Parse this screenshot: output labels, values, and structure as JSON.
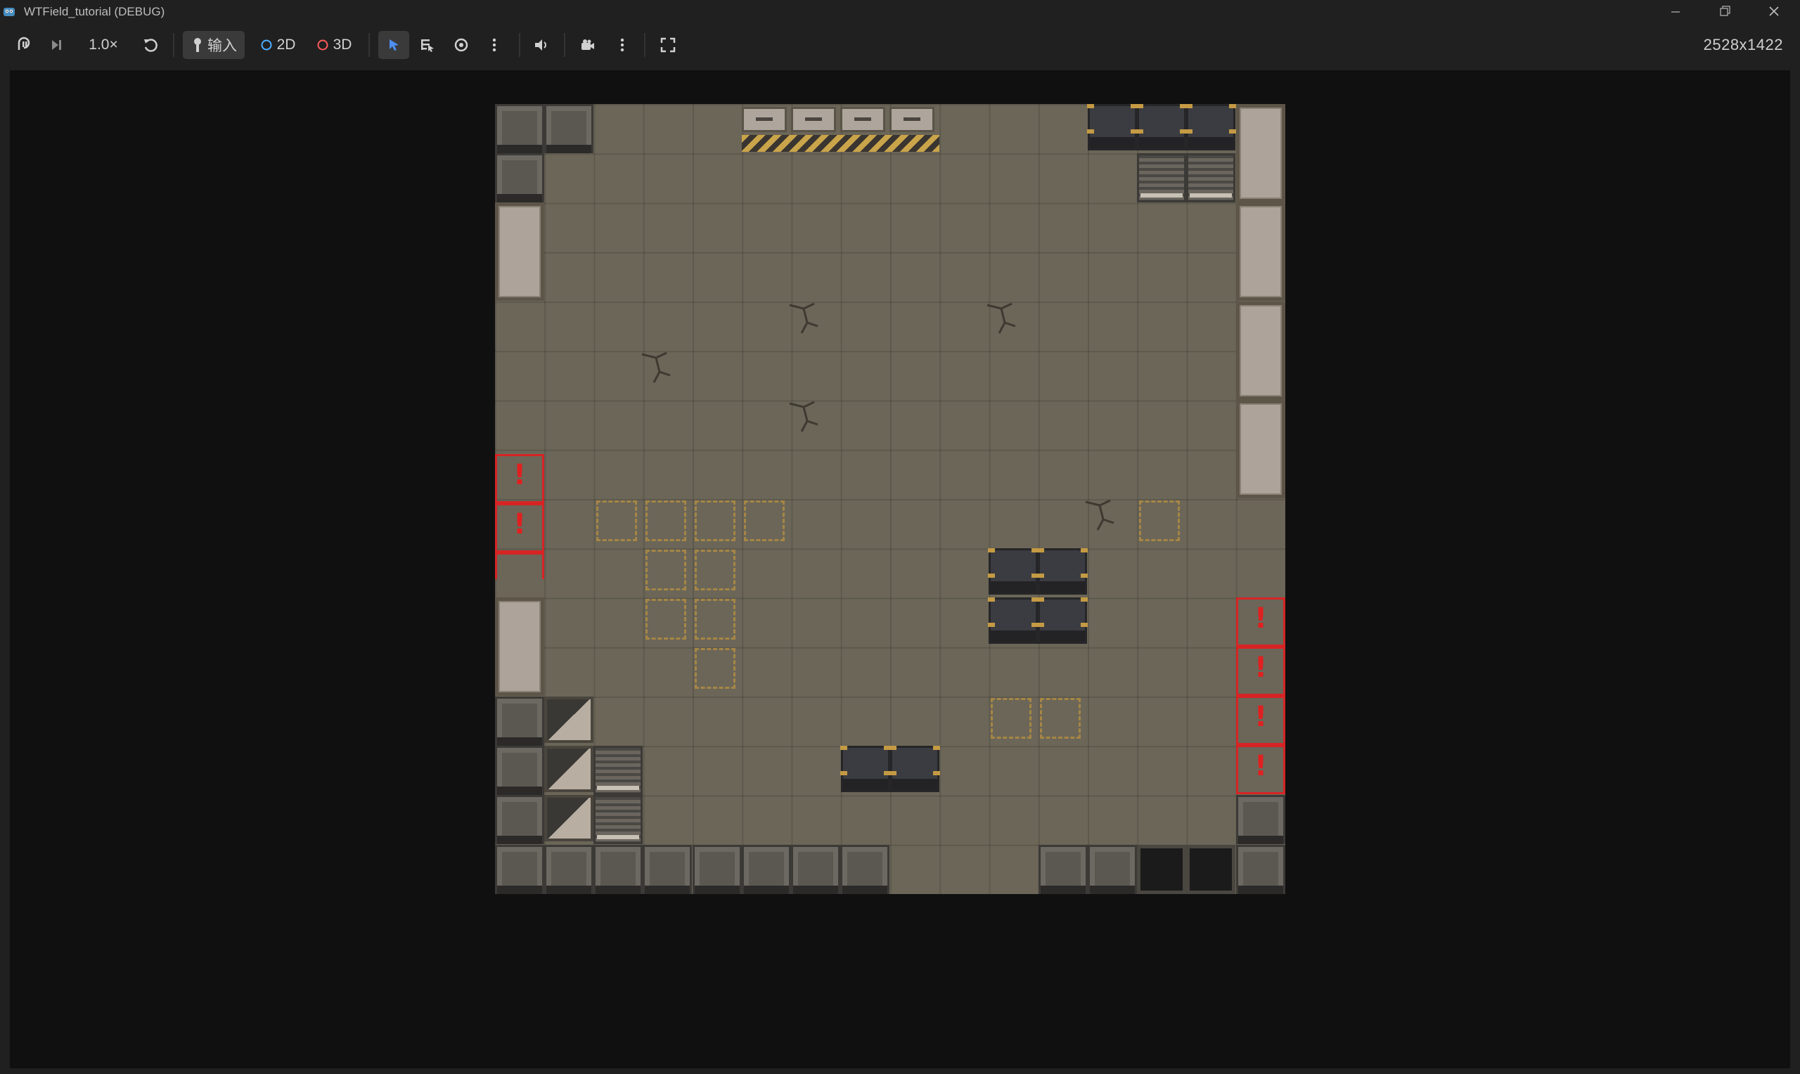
{
  "window": {
    "title": "WTField_tutorial (DEBUG)",
    "icon": "godot-icon",
    "controls": [
      "minimize-icon",
      "restore-icon",
      "close-icon"
    ]
  },
  "toolbar": {
    "speed_label": "1.0×",
    "input_label": "输入",
    "mode_2d_label": "2D",
    "mode_3d_label": "3D",
    "resolution_label": "2528x1422",
    "colors": {
      "accent": "#4d8ef0",
      "mode_2d": "#4fb0ff",
      "mode_3d": "#ff5a5a"
    }
  },
  "scene": {
    "map_grid": "16x16 tiles",
    "floor_color": "#6b6658",
    "danger_color": "#d62424",
    "hazard_marker": "!"
  }
}
